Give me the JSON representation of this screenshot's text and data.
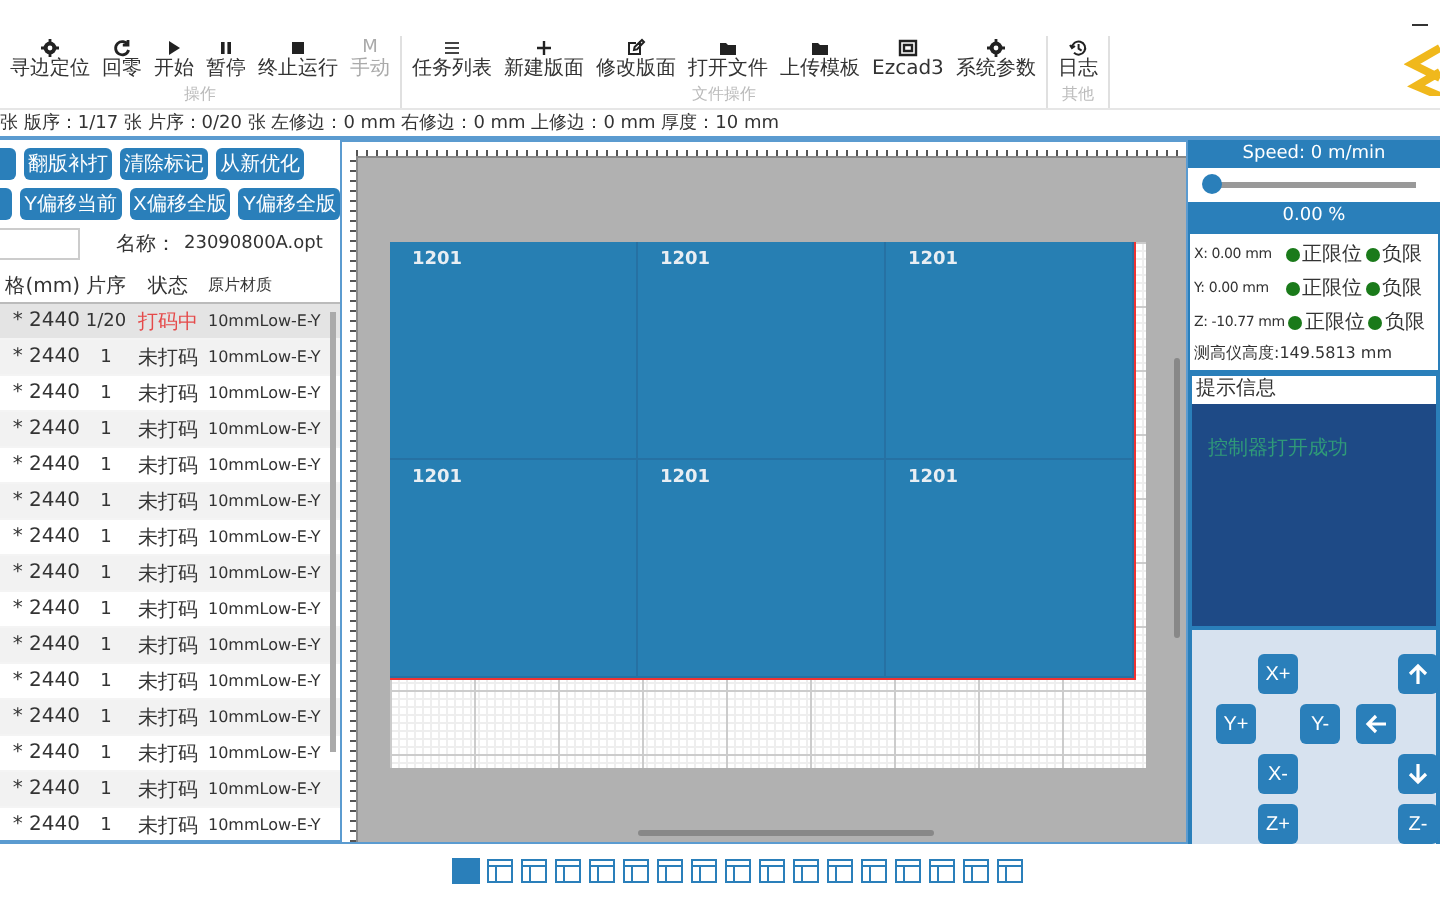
{
  "toolbar": {
    "groups": [
      {
        "label": "操作",
        "items": [
          {
            "label": "寻边定位",
            "kind": "gear",
            "disabled": false
          },
          {
            "label": "回零",
            "kind": "refresh",
            "disabled": false
          },
          {
            "label": "开始",
            "kind": "play",
            "disabled": false
          },
          {
            "label": "暂停",
            "kind": "pause",
            "disabled": false
          },
          {
            "label": "终止运行",
            "kind": "stop",
            "disabled": false
          },
          {
            "label": "手动",
            "kind": "letter",
            "glyph": "M",
            "disabled": true
          }
        ]
      },
      {
        "label": "文件操作",
        "items": [
          {
            "label": "任务列表",
            "kind": "list",
            "disabled": false
          },
          {
            "label": "新建版面",
            "kind": "plus",
            "disabled": false
          },
          {
            "label": "修改版面",
            "kind": "edit",
            "disabled": false
          },
          {
            "label": "打开文件",
            "kind": "folder",
            "disabled": false
          },
          {
            "label": "上传模板",
            "kind": "folder",
            "disabled": false
          },
          {
            "label": "Ezcad3",
            "kind": "frame",
            "disabled": false
          },
          {
            "label": "系统参数",
            "kind": "gear",
            "disabled": false
          }
        ]
      },
      {
        "label": "其他",
        "items": [
          {
            "label": "日志",
            "kind": "history",
            "disabled": false
          }
        ]
      }
    ]
  },
  "status_line": "张 版序：1/17 张 片序：0/20 张 左修边：0 mm 右修边：0 mm 上修边：0 mm 厚度：10 mm",
  "left_panel": {
    "button_rows": [
      [
        "翻版补打",
        "清除标记",
        "从新优化"
      ],
      [
        "Y偏移当前",
        "X偏移全版",
        "Y偏移全版"
      ]
    ],
    "name_label": "名称：",
    "name_value": "23090800A.opt",
    "table": {
      "columns": [
        "格(mm)",
        "片序",
        "状态",
        "原片材质"
      ],
      "rows": [
        {
          "size": "* 2440",
          "seq": "1/20",
          "status": "打码中",
          "kind": "printing",
          "material": "10mmLow-E-Y",
          "selected": true
        },
        {
          "size": "* 2440",
          "seq": "1",
          "status": "未打码",
          "kind": "pending",
          "material": "10mmLow-E-Y",
          "selected": false
        },
        {
          "size": "* 2440",
          "seq": "1",
          "status": "未打码",
          "kind": "pending",
          "material": "10mmLow-E-Y",
          "selected": false
        },
        {
          "size": "* 2440",
          "seq": "1",
          "status": "未打码",
          "kind": "pending",
          "material": "10mmLow-E-Y",
          "selected": false
        },
        {
          "size": "* 2440",
          "seq": "1",
          "status": "未打码",
          "kind": "pending",
          "material": "10mmLow-E-Y",
          "selected": false
        },
        {
          "size": "* 2440",
          "seq": "1",
          "status": "未打码",
          "kind": "pending",
          "material": "10mmLow-E-Y",
          "selected": false
        },
        {
          "size": "* 2440",
          "seq": "1",
          "status": "未打码",
          "kind": "pending",
          "material": "10mmLow-E-Y",
          "selected": false
        },
        {
          "size": "* 2440",
          "seq": "1",
          "status": "未打码",
          "kind": "pending",
          "material": "10mmLow-E-Y",
          "selected": false
        },
        {
          "size": "* 2440",
          "seq": "1",
          "status": "未打码",
          "kind": "pending",
          "material": "10mmLow-E-Y",
          "selected": false
        },
        {
          "size": "* 2440",
          "seq": "1",
          "status": "未打码",
          "kind": "pending",
          "material": "10mmLow-E-Y",
          "selected": false
        },
        {
          "size": "* 2440",
          "seq": "1",
          "status": "未打码",
          "kind": "pending",
          "material": "10mmLow-E-Y",
          "selected": false
        },
        {
          "size": "* 2440",
          "seq": "1",
          "status": "未打码",
          "kind": "pending",
          "material": "10mmLow-E-Y",
          "selected": false
        },
        {
          "size": "* 2440",
          "seq": "1",
          "status": "未打码",
          "kind": "pending",
          "material": "10mmLow-E-Y",
          "selected": false
        },
        {
          "size": "* 2440",
          "seq": "1",
          "status": "未打码",
          "kind": "pending",
          "material": "10mmLow-E-Y",
          "selected": false
        },
        {
          "size": "* 2440",
          "seq": "1",
          "status": "未打码",
          "kind": "pending",
          "material": "10mmLow-E-Y",
          "selected": false
        }
      ]
    }
  },
  "canvas": {
    "pieces": [
      {
        "label": "1201"
      },
      {
        "label": "1201"
      },
      {
        "label": "1201"
      },
      {
        "label": "1201"
      },
      {
        "label": "1201"
      },
      {
        "label": "1201"
      }
    ]
  },
  "pages": [
    {
      "selected": true
    },
    {
      "selected": false
    },
    {
      "selected": false
    },
    {
      "selected": false
    },
    {
      "selected": false
    },
    {
      "selected": false
    },
    {
      "selected": false
    },
    {
      "selected": false
    },
    {
      "selected": false
    },
    {
      "selected": false
    },
    {
      "selected": false
    },
    {
      "selected": false
    },
    {
      "selected": false
    },
    {
      "selected": false
    },
    {
      "selected": false
    },
    {
      "selected": false
    },
    {
      "selected": false
    }
  ],
  "right_panel": {
    "speed": "Speed: 0 m/min",
    "slider": {
      "level": 0
    },
    "progress": "0.00 %",
    "axes": [
      {
        "axis": "X:",
        "value": "0.00",
        "unit": "mm",
        "limits": [
          {
            "label": "正限位",
            "on": true
          },
          {
            "label": "负限",
            "on": true
          }
        ]
      },
      {
        "axis": "Y:",
        "value": "0.00",
        "unit": "mm",
        "limits": [
          {
            "label": "正限位",
            "on": true
          },
          {
            "label": "负限",
            "on": true
          }
        ]
      },
      {
        "axis": "Z:",
        "value": "-10.77",
        "unit": "mm",
        "limits": [
          {
            "label": "正限位",
            "on": true
          },
          {
            "label": "负限",
            "on": true
          }
        ]
      }
    ],
    "height": "测高仪高度:149.5813 mm",
    "message_title": "提示信息",
    "messages": [
      "控制器打开成功"
    ],
    "jog": [
      {
        "kind": "text",
        "label": "X+"
      },
      {
        "kind": "up"
      },
      {
        "kind": "text",
        "label": "Y+"
      },
      {
        "kind": "text",
        "label": "Y-"
      },
      {
        "kind": "left"
      },
      {
        "kind": "text",
        "label": "X-"
      },
      {
        "kind": "down"
      },
      {
        "kind": "text",
        "label": "Z+"
      },
      {
        "kind": "text",
        "label": "Z-"
      }
    ]
  }
}
